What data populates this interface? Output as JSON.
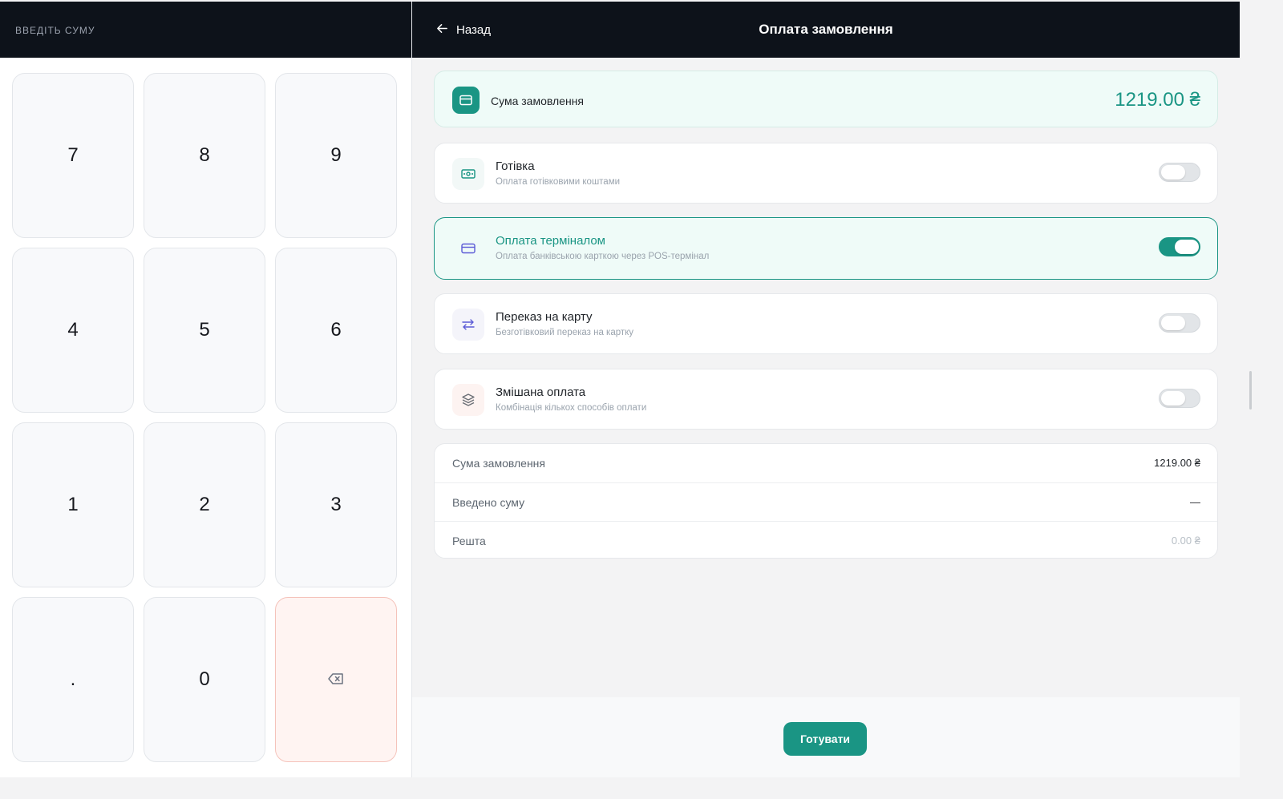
{
  "left_panel": {
    "label": "ВВЕДІТЬ СУМУ",
    "keys": [
      "7",
      "8",
      "9",
      "4",
      "5",
      "6",
      "1",
      "2",
      "3",
      ".",
      "0"
    ],
    "backspace_icon": "backspace-icon"
  },
  "header": {
    "back_label": "Назад",
    "title": "Оплата замовлення"
  },
  "order_total": {
    "label": "Сума замовлення",
    "amount": "1219.00 ₴",
    "icon": "card-icon"
  },
  "payment_methods": [
    {
      "title": "Готівка",
      "subtitle": "Оплата готівковими коштами",
      "icon": "cash-icon",
      "enabled": false
    },
    {
      "title": "Оплата терміналом",
      "subtitle": "Оплата банківською карткою через POS-термінал",
      "icon": "card-icon",
      "enabled": true
    },
    {
      "title": "Переказ на карту",
      "subtitle": "Безготівковий переказ на картку",
      "icon": "transfer-icon",
      "enabled": false
    },
    {
      "title": "Змішана оплата",
      "subtitle": "Комбінація кількох способів оплати",
      "icon": "layers-icon",
      "enabled": false
    }
  ],
  "summary": {
    "rows": [
      {
        "label": "Сума замовлення",
        "value": "1219.00 ₴"
      },
      {
        "label": "Введено суму",
        "value": "—"
      },
      {
        "label": "Решта",
        "value": "0.00 ₴"
      }
    ]
  },
  "footer": {
    "submit_label": "Готувати"
  },
  "colors": {
    "accent": "#1a9584",
    "header_bg": "#0d121a",
    "backspace_bg": "#fff4f2"
  }
}
